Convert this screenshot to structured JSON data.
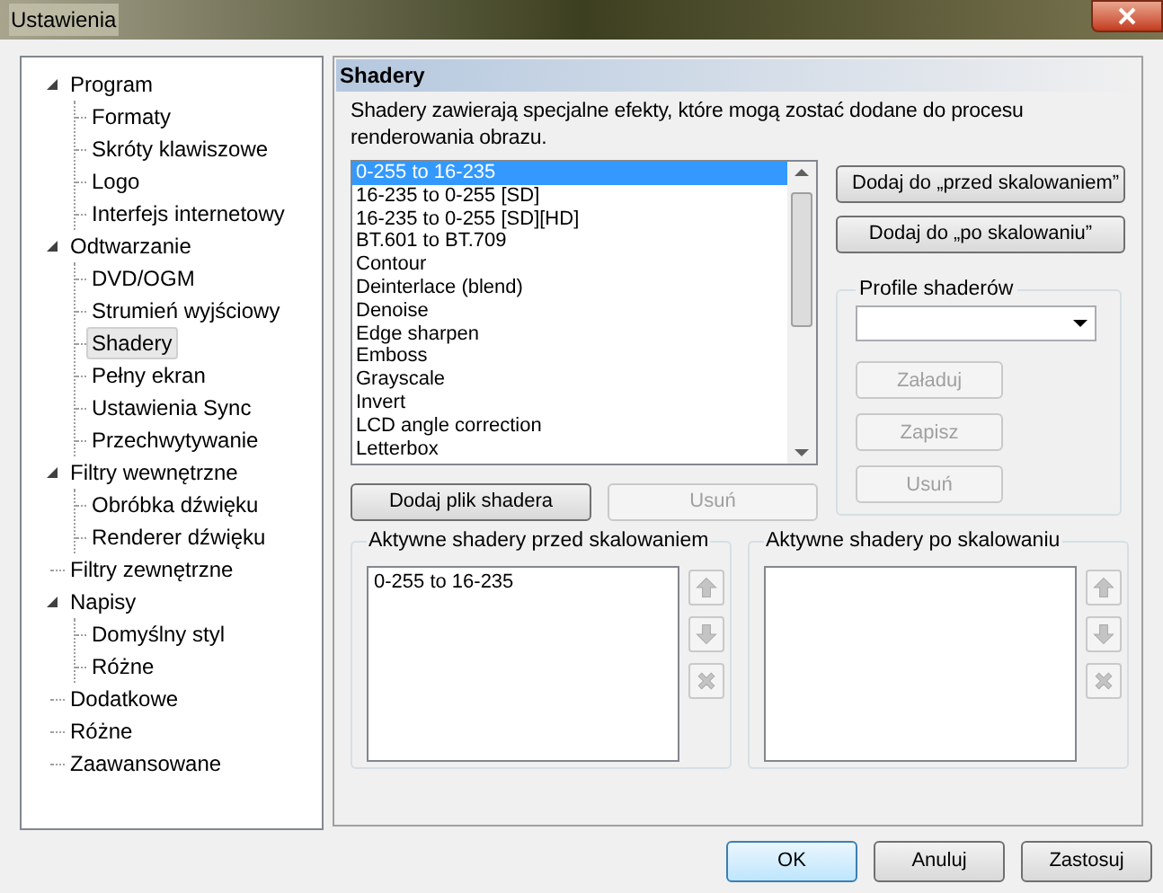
{
  "window": {
    "title": "Ustawienia"
  },
  "tree": [
    {
      "label": "Program",
      "expanded": true,
      "selected": false,
      "children": [
        {
          "label": "Formaty",
          "selected": false
        },
        {
          "label": "Skróty klawiszowe",
          "selected": false
        },
        {
          "label": "Logo",
          "selected": false
        },
        {
          "label": "Interfejs internetowy",
          "selected": false
        }
      ]
    },
    {
      "label": "Odtwarzanie",
      "expanded": true,
      "selected": false,
      "children": [
        {
          "label": "DVD/OGM",
          "selected": false
        },
        {
          "label": "Strumień wyjściowy",
          "selected": false
        },
        {
          "label": "Shadery",
          "selected": true
        },
        {
          "label": "Pełny ekran",
          "selected": false
        },
        {
          "label": "Ustawienia Sync",
          "selected": false
        },
        {
          "label": "Przechwytywanie",
          "selected": false
        }
      ]
    },
    {
      "label": "Filtry wewnętrzne",
      "expanded": true,
      "selected": false,
      "children": [
        {
          "label": "Obróbka dźwięku",
          "selected": false
        },
        {
          "label": "Renderer dźwięku",
          "selected": false
        }
      ]
    },
    {
      "label": "Filtry zewnętrzne",
      "selected": false
    },
    {
      "label": "Napisy",
      "expanded": true,
      "selected": false,
      "children": [
        {
          "label": "Domyślny styl",
          "selected": false
        },
        {
          "label": "Różne",
          "selected": false
        }
      ]
    },
    {
      "label": "Dodatkowe",
      "selected": false
    },
    {
      "label": "Różne",
      "selected": false
    },
    {
      "label": "Zaawansowane",
      "selected": false
    }
  ],
  "panel": {
    "title": "Shadery",
    "description": "Shadery zawierają specjalne efekty, które mogą zostać dodane do procesu renderowania obrazu.",
    "shader_list": [
      {
        "label": "0-255 to 16-235",
        "selected": true
      },
      {
        "label": "16-235 to 0-255 [SD]",
        "selected": false
      },
      {
        "label": "16-235 to 0-255 [SD][HD]",
        "selected": false
      },
      {
        "label": "BT.601 to BT.709",
        "selected": false
      },
      {
        "label": "Contour",
        "selected": false
      },
      {
        "label": "Deinterlace (blend)",
        "selected": false
      },
      {
        "label": "Denoise",
        "selected": false
      },
      {
        "label": "Edge sharpen",
        "selected": false
      },
      {
        "label": "Emboss",
        "selected": false
      },
      {
        "label": "Grayscale",
        "selected": false
      },
      {
        "label": "Invert",
        "selected": false
      },
      {
        "label": "LCD angle correction",
        "selected": false
      },
      {
        "label": "Letterbox",
        "selected": false
      }
    ],
    "list_buttons": [
      {
        "label": "Dodaj plik shadera",
        "disabled": false
      },
      {
        "label": "Usuń",
        "disabled": true
      }
    ],
    "add_buttons": [
      {
        "label": "Dodaj do „przed skalowaniem”",
        "disabled": false
      },
      {
        "label": "Dodaj do „po skalowaniu”",
        "disabled": false
      }
    ],
    "profiles": {
      "title": "Profile shaderów",
      "buttons": [
        {
          "label": "Załaduj",
          "disabled": true
        },
        {
          "label": "Zapisz",
          "disabled": true
        },
        {
          "label": "Usuń",
          "disabled": true
        }
      ]
    },
    "active_groups": [
      {
        "title": "Aktywne shadery przed skalowaniem",
        "items": [
          "0-255 to 16-235"
        ],
        "tools": [
          {
            "kind": "up",
            "disabled": true
          },
          {
            "kind": "down",
            "disabled": true
          },
          {
            "kind": "remove",
            "disabled": true
          }
        ]
      },
      {
        "title": "Aktywne shadery po skalowaniu",
        "tools": [
          {
            "kind": "up",
            "disabled": true
          },
          {
            "kind": "down",
            "disabled": true
          },
          {
            "kind": "remove",
            "disabled": true
          }
        ]
      }
    ]
  },
  "dialog_buttons": [
    {
      "label": "OK",
      "default": true
    },
    {
      "label": "Anuluj",
      "default": false
    },
    {
      "label": "Zastosuj",
      "default": false
    }
  ]
}
